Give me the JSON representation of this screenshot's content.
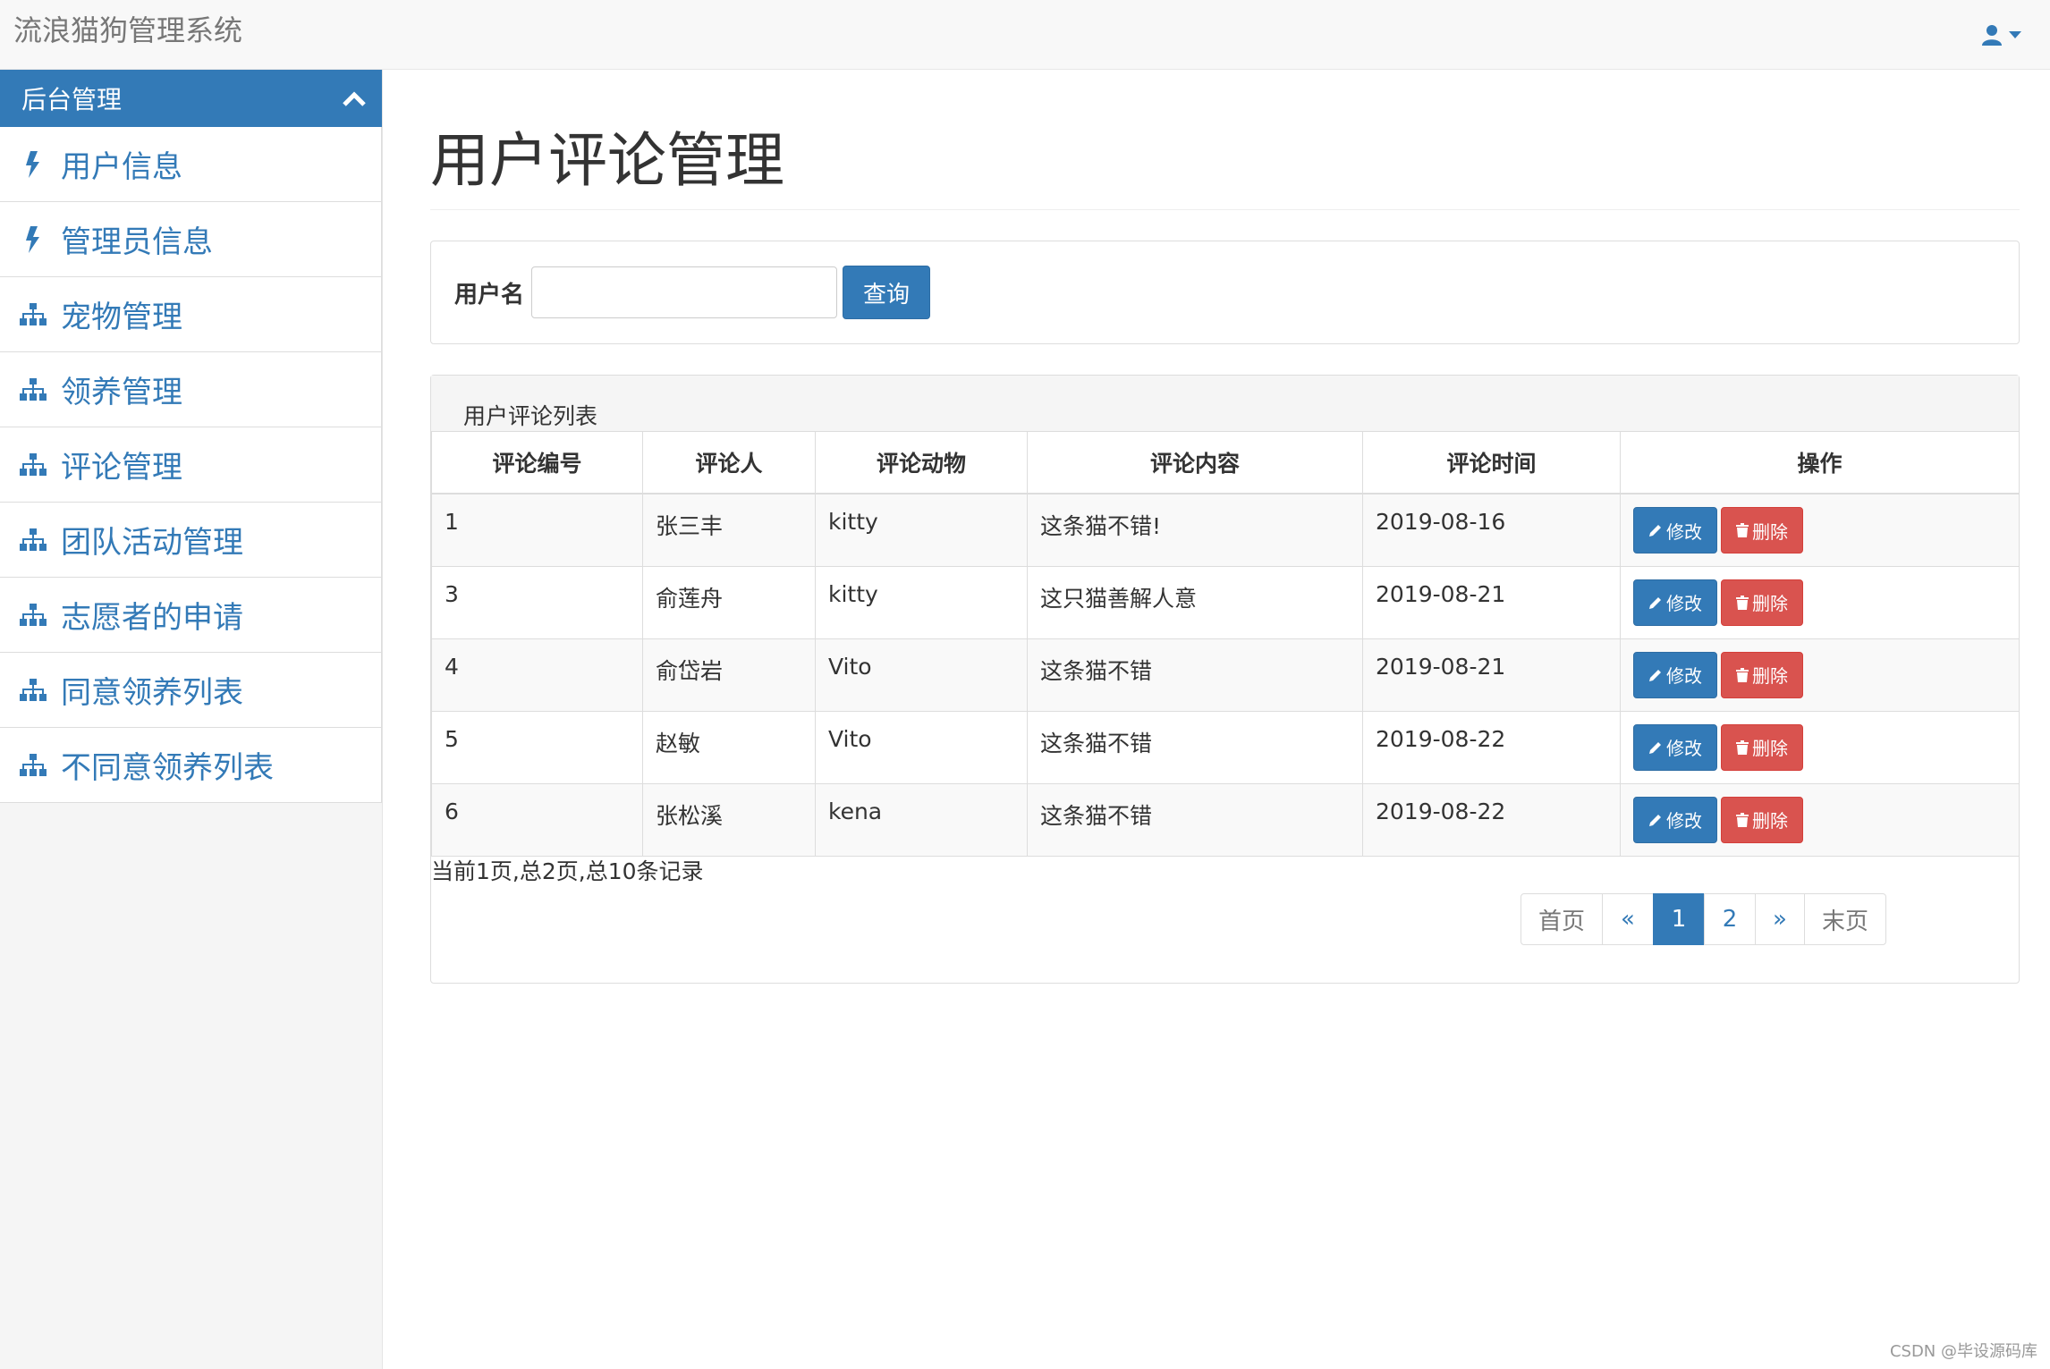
{
  "app": {
    "title": "流浪猫狗管理系统"
  },
  "sidebar": {
    "header": "后台管理",
    "items": [
      {
        "label": "用户信息",
        "icon": "bolt-icon"
      },
      {
        "label": "管理员信息",
        "icon": "bolt-icon"
      },
      {
        "label": "宠物管理",
        "icon": "sitemap-icon"
      },
      {
        "label": "领养管理",
        "icon": "sitemap-icon"
      },
      {
        "label": "评论管理",
        "icon": "sitemap-icon"
      },
      {
        "label": "团队活动管理",
        "icon": "sitemap-icon"
      },
      {
        "label": "志愿者的申请",
        "icon": "sitemap-icon"
      },
      {
        "label": "同意领养列表",
        "icon": "sitemap-icon"
      },
      {
        "label": "不同意领养列表",
        "icon": "sitemap-icon"
      }
    ]
  },
  "page": {
    "title": "用户评论管理"
  },
  "search": {
    "label": "用户名",
    "value": "",
    "placeholder": "",
    "button": "查询"
  },
  "list": {
    "heading": "用户评论列表",
    "columns": [
      "评论编号",
      "评论人",
      "评论动物",
      "评论内容",
      "评论时间",
      "操作"
    ],
    "rows": [
      [
        "1",
        "张三丰",
        "kitty",
        "这条猫不错!",
        "2019-08-16"
      ],
      [
        "3",
        "俞莲舟",
        "kitty",
        "这只猫善解人意",
        "2019-08-21"
      ],
      [
        "4",
        "俞岱岩",
        "Vito",
        "这条猫不错",
        "2019-08-21"
      ],
      [
        "5",
        "赵敏",
        "Vito",
        "这条猫不错",
        "2019-08-22"
      ],
      [
        "6",
        "张松溪",
        "kena",
        "这条猫不错",
        "2019-08-22"
      ]
    ],
    "edit_label": "修改",
    "delete_label": "删除"
  },
  "summary": "当前1页,总2页,总10条记录",
  "pagination": {
    "items": [
      "首页",
      "«",
      "1",
      "2",
      "»",
      "末页"
    ],
    "active": "1"
  },
  "watermark": "CSDN @毕设源码库",
  "colors": {
    "primary": "#337ab7",
    "danger": "#d9534f"
  }
}
